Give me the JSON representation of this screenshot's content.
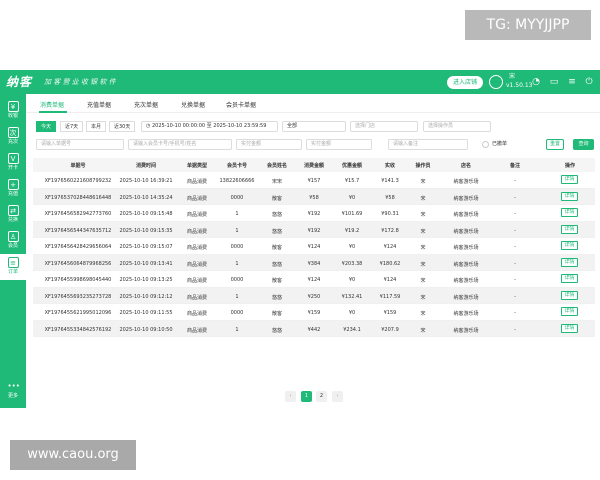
{
  "watermark_top": "TG: MYYJJPP",
  "watermark_bottom": "www.caou.org",
  "app": {
    "logo": "纳客",
    "slogan": "加 客 营 业 收 银 软 件",
    "shop_button": "进入店铺",
    "user_name": "宋",
    "version": "v1.50.13"
  },
  "sidebar": [
    {
      "label": "收银",
      "icon": "cashier-icon",
      "glyph": "¥"
    },
    {
      "label": "充次",
      "icon": "count-icon",
      "glyph": "次"
    },
    {
      "label": "开卡",
      "icon": "vip-card-icon",
      "glyph": "V"
    },
    {
      "label": "充值",
      "icon": "recharge-icon",
      "glyph": "+"
    },
    {
      "label": "兑换",
      "icon": "exchange-icon",
      "glyph": "⇄"
    },
    {
      "label": "会员",
      "icon": "member-icon",
      "glyph": "♙"
    },
    {
      "label": "订单",
      "icon": "order-icon",
      "glyph": "≡"
    },
    {
      "label": "更多",
      "icon": "more-icon",
      "glyph": "•••"
    }
  ],
  "tabs": [
    "消费单据",
    "充值单据",
    "充次单据",
    "兑换单据",
    "会员卡单据"
  ],
  "filters": {
    "quick": [
      "今天",
      "近7天",
      "本月",
      "近30天"
    ],
    "date_start": "2025-10-10 00:00:00",
    "date_to": "至",
    "date_end": "2025-10-10 23:59:59",
    "type_value": "全部",
    "store_placeholder": "选择门店",
    "operator_placeholder": "选择操作员",
    "order_placeholder": "请输入单据号",
    "member_placeholder": "请输入会员卡号/手机号/姓名",
    "amount_min_placeholder": "实付金额",
    "amount_max_placeholder": "实付金额",
    "remark_placeholder": "请输入备注",
    "cancelled_label": "已撤单",
    "reset_button": "重置",
    "search_button": "查询"
  },
  "table": {
    "headers": [
      "单据号",
      "消费时间",
      "单据类型",
      "会员卡号",
      "会员姓名",
      "消费金额",
      "优惠金额",
      "实收",
      "操作员",
      "店名",
      "备注",
      "操作"
    ],
    "detail_label": "详情",
    "rows": [
      [
        "XF1976560221608799232",
        "2025-10-10 16:39:21",
        "商品消费",
        "13822606666",
        "宋宋",
        "¥157",
        "¥15.7",
        "¥141.3",
        "宋",
        "纳客游乐场",
        "-"
      ],
      [
        "XF1976537028448616448",
        "2025-10-10 14:35:24",
        "商品消费",
        "0000",
        "散客",
        "¥58",
        "¥0",
        "¥58",
        "宋",
        "纳客游乐场",
        "-"
      ],
      [
        "XF1976456582942773760",
        "2025-10-10 09:15:48",
        "商品消费",
        "1",
        "悠悠",
        "¥192",
        "¥101.69",
        "¥90.31",
        "宋",
        "纳客游乐场",
        "-"
      ],
      [
        "XF1976456544347635712",
        "2025-10-10 09:15:35",
        "商品消费",
        "1",
        "悠悠",
        "¥192",
        "¥19.2",
        "¥172.8",
        "宋",
        "纳客游乐场",
        "-"
      ],
      [
        "XF1976456428429656064",
        "2025-10-10 09:15:07",
        "商品消费",
        "0000",
        "散客",
        "¥124",
        "¥0",
        "¥124",
        "宋",
        "纳客游乐场",
        "-"
      ],
      [
        "XF1976456064879968256",
        "2025-10-10 09:13:41",
        "商品消费",
        "1",
        "悠悠",
        "¥384",
        "¥203.38",
        "¥180.62",
        "宋",
        "纳客游乐场",
        "-"
      ],
      [
        "XF1976455998698045440",
        "2025-10-10 09:13:25",
        "商品消费",
        "0000",
        "散客",
        "¥124",
        "¥0",
        "¥124",
        "宋",
        "纳客游乐场",
        "-"
      ],
      [
        "XF1976455693235273728",
        "2025-10-10 09:12:12",
        "商品消费",
        "1",
        "悠悠",
        "¥250",
        "¥132.41",
        "¥117.59",
        "宋",
        "纳客游乐场",
        "-"
      ],
      [
        "XF1976455621995012096",
        "2025-10-10 09:11:55",
        "商品消费",
        "0000",
        "散客",
        "¥159",
        "¥0",
        "¥159",
        "宋",
        "纳客游乐场",
        "-"
      ],
      [
        "XF1976455334842576192",
        "2025-10-10 09:10:50",
        "商品消费",
        "1",
        "悠悠",
        "¥442",
        "¥234.1",
        "¥207.9",
        "宋",
        "纳客游乐场",
        "-"
      ]
    ]
  },
  "pagination": {
    "prev": "‹",
    "pages": [
      "1",
      "2"
    ],
    "next": "›",
    "current": "1"
  },
  "colors": {
    "brand": "#1fb978",
    "header_bg": "#f5f5f5"
  }
}
